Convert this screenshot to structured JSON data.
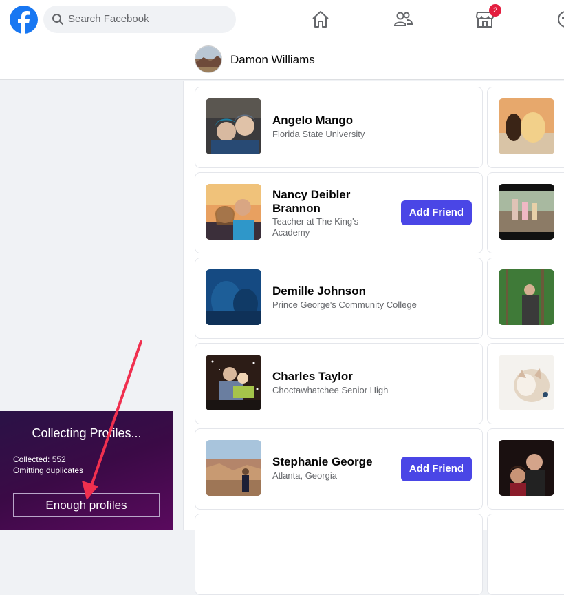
{
  "header": {
    "search_placeholder": "Search Facebook",
    "marketplace_badge": "2"
  },
  "profile": {
    "name": "Damon Williams"
  },
  "people": [
    {
      "name": "Angelo Mango",
      "subtitle": "Florida State University",
      "button": ""
    },
    {
      "name": "Nancy Deibler Brannon",
      "subtitle": "Teacher at The King's Academy",
      "button": "Add Friend"
    },
    {
      "name": "Demille Johnson",
      "subtitle": "Prince George's Community College",
      "button": ""
    },
    {
      "name": "Charles Taylor",
      "subtitle": "Choctawhatchee Senior High",
      "button": ""
    },
    {
      "name": "Stephanie George",
      "subtitle": "Atlanta, Georgia",
      "button": "Add Friend"
    }
  ],
  "collector": {
    "title": "Collecting Profiles...",
    "collected": "Collected: 552",
    "status": "Omitting duplicates",
    "button": "Enough profiles"
  },
  "colors": {
    "brand": "#1877f2",
    "add_friend": "#4a46e6",
    "badge": "#e41e3f",
    "arrow": "#f0304f"
  }
}
